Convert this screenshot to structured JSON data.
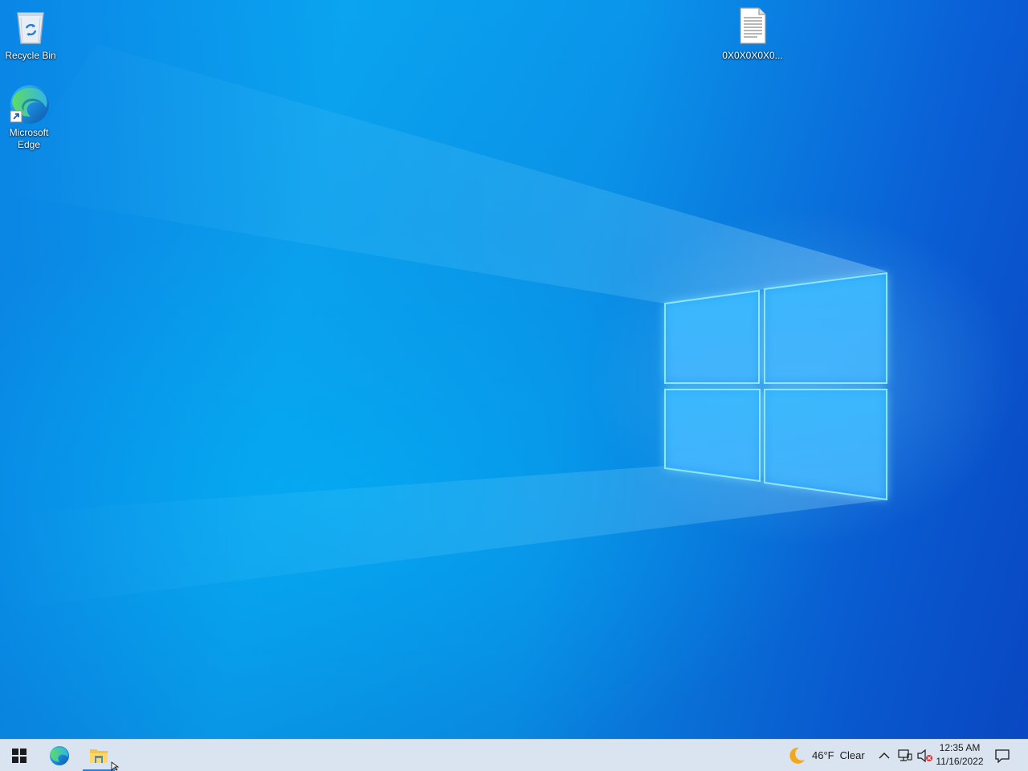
{
  "desktop": {
    "icons": [
      {
        "label": "Recycle Bin",
        "icon": "recycle-bin-icon"
      },
      {
        "label": "Microsoft Edge",
        "icon": "edge-icon"
      },
      {
        "label": "0X0X0X0X0...",
        "icon": "text-file-icon"
      }
    ],
    "wallpaper": {
      "accent": "#0a95ea",
      "logo_color": "#3fc6ff"
    }
  },
  "taskbar": {
    "start": {
      "icon": "windows-start-icon"
    },
    "pinned": [
      {
        "name": "Microsoft Edge",
        "icon": "edge-icon"
      },
      {
        "name": "File Explorer",
        "icon": "folder-icon"
      }
    ],
    "weather": {
      "icon": "moon-icon",
      "temp": "46°F",
      "condition": "Clear"
    },
    "tray": {
      "chevron": "chevron-up-icon",
      "network": "network-icon",
      "volume": "volume-muted-icon"
    },
    "clock": {
      "time": "12:35 AM",
      "date": "11/16/2022"
    },
    "notifications": {
      "icon": "action-center-icon"
    },
    "background": "#d9e4f0"
  }
}
